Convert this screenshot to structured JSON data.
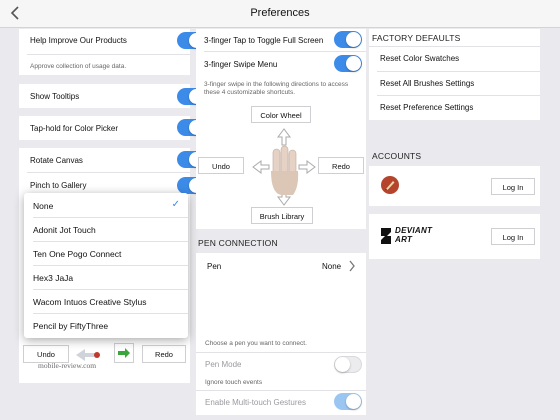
{
  "header": {
    "title": "Preferences"
  },
  "left": {
    "help_improve": {
      "label": "Help Improve Our Products",
      "sub": "Approve collection of usage data.",
      "on": true
    },
    "show_tooltips": {
      "label": "Show Tooltips",
      "on": true
    },
    "taphold": {
      "label": "Tap-hold for Color Picker",
      "on": true
    },
    "rotate_canvas": {
      "label": "Rotate Canvas",
      "on": true
    },
    "pinch_gallery": {
      "label": "Pinch to Gallery",
      "on": true
    },
    "undo_label": "Undo",
    "redo_label": "Redo"
  },
  "stylus_dropdown": {
    "options": [
      "None",
      "Adonit Jot Touch",
      "Ten One Pogo Connect",
      "Hex3 JaJa",
      "Wacom Intuos Creative Stylus",
      "Pencil by FiftyThree"
    ],
    "selected": "None"
  },
  "middle": {
    "three_finger_tap": {
      "label": "3-finger Tap to Toggle Full Screen",
      "on": true
    },
    "three_finger_swipe": {
      "label": "3-finger Swipe Menu",
      "on": true,
      "desc": "3-finger swipe in the following directions to access these 4 customizable shortcuts."
    },
    "gesture": {
      "up": "Color Wheel",
      "left": "Undo",
      "right": "Redo",
      "down": "Brush Library"
    },
    "pen_connection": {
      "heading": "PEN CONNECTION",
      "pen_label": "Pen",
      "pen_value": "None",
      "hint": "Choose a pen you want to connect.",
      "pen_mode": "Pen Mode",
      "ignore_touch": "Ignore touch events",
      "multitouch": "Enable Multi-touch Gestures"
    }
  },
  "right": {
    "factory_heading": "FACTORY DEFAULTS",
    "reset_swatches": "Reset Color Swatches",
    "reset_brushes": "Reset All Brushes Settings",
    "reset_prefs": "Reset Preference Settings",
    "accounts_heading": "ACCOUNTS",
    "login_label": "Log In",
    "deviantart_logo": "DEVIANT ART"
  },
  "watermark": "mobile-review.com",
  "colors": {
    "accent": "#3d8be8",
    "background": "#eaeaee",
    "toggle_on": "#3d8be8"
  }
}
